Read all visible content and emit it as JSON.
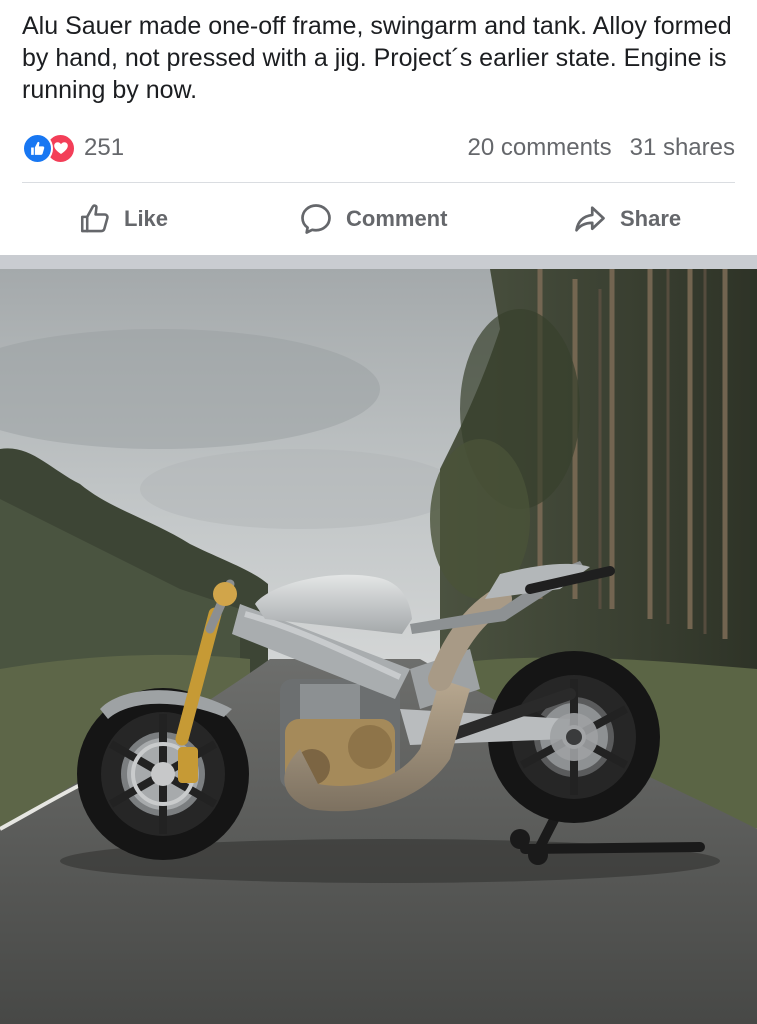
{
  "post": {
    "caption": "Alu Sauer made one-off frame, swingarm and tank. Alloy formed by hand, not pressed with a jig. Project´s earlier state. Engine is running by now.",
    "reactions": {
      "icons": [
        "like-icon",
        "love-icon"
      ],
      "count": "251"
    },
    "comments": "20 comments",
    "shares": "31 shares"
  },
  "actions": {
    "like": "Like",
    "comment": "Comment",
    "share": "Share"
  },
  "colors": {
    "like_blue": "#1877f2",
    "love_red": "#f33e58",
    "secondary_text": "#65676b",
    "divider": "#dadde1"
  },
  "photo": {
    "subject": "custom-motorcycle-on-paddock-stand"
  }
}
